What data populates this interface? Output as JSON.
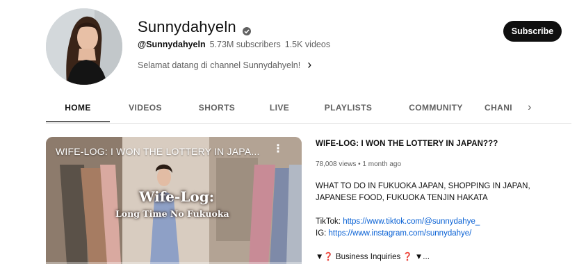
{
  "channel": {
    "name": "Sunnydahyeln",
    "handle": "@Sunnydahyeln",
    "subscribers": "5.73M subscribers",
    "videos": "1.5K videos",
    "tagline": "Selamat datang di channel Sunnydahyeln!",
    "tagline_arrow": "›",
    "subscribe_label": "Subscribe"
  },
  "tabs": [
    {
      "label": "HOME",
      "active": true
    },
    {
      "label": "VIDEOS"
    },
    {
      "label": "SHORTS"
    },
    {
      "label": "LIVE"
    },
    {
      "label": "PLAYLISTS"
    },
    {
      "label": "COMMUNITY"
    },
    {
      "label": "CHANI"
    }
  ],
  "tabs_more_icon": "›",
  "featured": {
    "thumbnail_title": "WIFE-LOG: I WON THE LOTTERY IN JAPA...",
    "thumbnail_caption_1": "Wife-Log:",
    "thumbnail_caption_2": "Long Time No Fukuoka",
    "more_icon": "⋮",
    "title": "WIFE-LOG: I WON THE LOTTERY IN JAPAN???",
    "stats": "78,008 views • 1 month ago",
    "desc_line1": "WHAT TO DO IN FUKUOKA JAPAN, SHOPPING IN JAPAN,",
    "desc_line2": "JAPANESE FOOD, FUKUOKA TENJIN HAKATA",
    "tiktok_label": "TikTok: ",
    "tiktok_url": "https://www.tiktok.com/@sunnydahye_",
    "ig_label": "IG: ",
    "ig_url": "https://www.instagram.com/sunnydahye/",
    "business": "▼❓ Business Inquiries ❓ ▼..."
  }
}
